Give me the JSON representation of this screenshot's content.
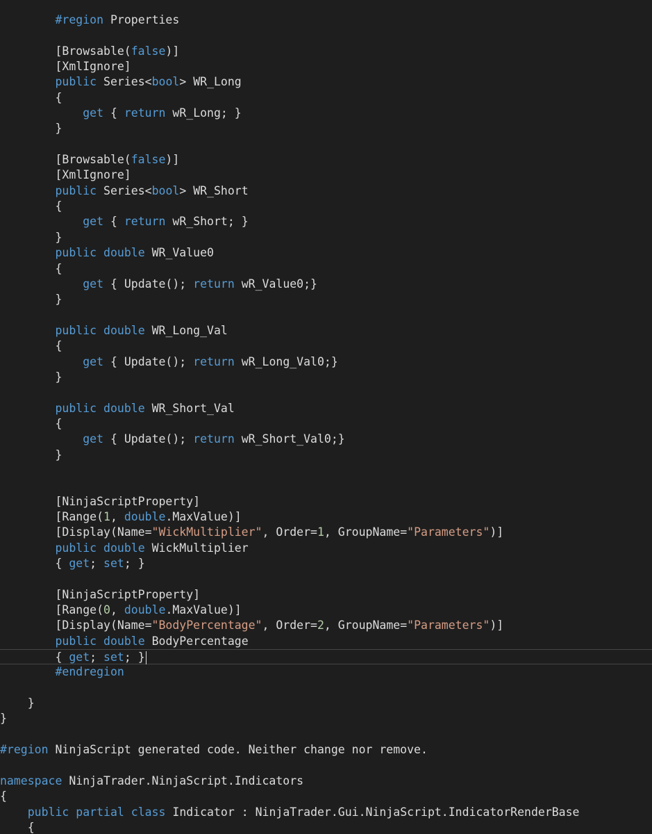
{
  "editor": {
    "theme": {
      "background": "#1e1e1e",
      "text": "#dcdcdc",
      "keyword": "#569cd6",
      "string": "#d69d85",
      "number": "#b5cea8"
    },
    "current_line_index": 41,
    "lines": [
      [
        {
          "t": "        "
        },
        {
          "t": "#region",
          "k": "kw"
        },
        {
          "t": " Properties"
        }
      ],
      [],
      [
        {
          "t": "        [Browsable("
        },
        {
          "t": "false",
          "k": "kw"
        },
        {
          "t": ")]"
        }
      ],
      [
        {
          "t": "        [XmlIgnore]"
        }
      ],
      [
        {
          "t": "        "
        },
        {
          "t": "public",
          "k": "kw"
        },
        {
          "t": " Series<"
        },
        {
          "t": "bool",
          "k": "kw"
        },
        {
          "t": "> WR_Long"
        }
      ],
      [
        {
          "t": "        {"
        }
      ],
      [
        {
          "t": "            "
        },
        {
          "t": "get",
          "k": "kw"
        },
        {
          "t": " { "
        },
        {
          "t": "return",
          "k": "kw"
        },
        {
          "t": " wR_Long; }"
        }
      ],
      [
        {
          "t": "        }"
        }
      ],
      [],
      [
        {
          "t": "        [Browsable("
        },
        {
          "t": "false",
          "k": "kw"
        },
        {
          "t": ")]"
        }
      ],
      [
        {
          "t": "        [XmlIgnore]"
        }
      ],
      [
        {
          "t": "        "
        },
        {
          "t": "public",
          "k": "kw"
        },
        {
          "t": " Series<"
        },
        {
          "t": "bool",
          "k": "kw"
        },
        {
          "t": "> WR_Short"
        }
      ],
      [
        {
          "t": "        {"
        }
      ],
      [
        {
          "t": "            "
        },
        {
          "t": "get",
          "k": "kw"
        },
        {
          "t": " { "
        },
        {
          "t": "return",
          "k": "kw"
        },
        {
          "t": " wR_Short; }"
        }
      ],
      [
        {
          "t": "        }"
        }
      ],
      [
        {
          "t": "        "
        },
        {
          "t": "public",
          "k": "kw"
        },
        {
          "t": " "
        },
        {
          "t": "double",
          "k": "kw"
        },
        {
          "t": " WR_Value0"
        }
      ],
      [
        {
          "t": "        {"
        }
      ],
      [
        {
          "t": "            "
        },
        {
          "t": "get",
          "k": "kw"
        },
        {
          "t": " { Update(); "
        },
        {
          "t": "return",
          "k": "kw"
        },
        {
          "t": " wR_Value0;}"
        }
      ],
      [
        {
          "t": "        }"
        }
      ],
      [],
      [
        {
          "t": "        "
        },
        {
          "t": "public",
          "k": "kw"
        },
        {
          "t": " "
        },
        {
          "t": "double",
          "k": "kw"
        },
        {
          "t": " WR_Long_Val"
        }
      ],
      [
        {
          "t": "        {"
        }
      ],
      [
        {
          "t": "            "
        },
        {
          "t": "get",
          "k": "kw"
        },
        {
          "t": " { Update(); "
        },
        {
          "t": "return",
          "k": "kw"
        },
        {
          "t": " wR_Long_Val0;}"
        }
      ],
      [
        {
          "t": "        }"
        }
      ],
      [],
      [
        {
          "t": "        "
        },
        {
          "t": "public",
          "k": "kw"
        },
        {
          "t": " "
        },
        {
          "t": "double",
          "k": "kw"
        },
        {
          "t": " WR_Short_Val"
        }
      ],
      [
        {
          "t": "        {"
        }
      ],
      [
        {
          "t": "            "
        },
        {
          "t": "get",
          "k": "kw"
        },
        {
          "t": " { Update(); "
        },
        {
          "t": "return",
          "k": "kw"
        },
        {
          "t": " wR_Short_Val0;}"
        }
      ],
      [
        {
          "t": "        }"
        }
      ],
      [],
      [],
      [
        {
          "t": "        [NinjaScriptProperty]"
        }
      ],
      [
        {
          "t": "        [Range("
        },
        {
          "t": "1",
          "k": "num"
        },
        {
          "t": ", "
        },
        {
          "t": "double",
          "k": "kw"
        },
        {
          "t": ".MaxValue)]"
        }
      ],
      [
        {
          "t": "        [Display(Name="
        },
        {
          "t": "\"WickMultiplier\"",
          "k": "str"
        },
        {
          "t": ", Order="
        },
        {
          "t": "1",
          "k": "num"
        },
        {
          "t": ", GroupName="
        },
        {
          "t": "\"Parameters\"",
          "k": "str"
        },
        {
          "t": ")]"
        }
      ],
      [
        {
          "t": "        "
        },
        {
          "t": "public",
          "k": "kw"
        },
        {
          "t": " "
        },
        {
          "t": "double",
          "k": "kw"
        },
        {
          "t": " WickMultiplier"
        }
      ],
      [
        {
          "t": "        { "
        },
        {
          "t": "get",
          "k": "kw"
        },
        {
          "t": "; "
        },
        {
          "t": "set",
          "k": "kw"
        },
        {
          "t": "; }"
        }
      ],
      [],
      [
        {
          "t": "        [NinjaScriptProperty]"
        }
      ],
      [
        {
          "t": "        [Range("
        },
        {
          "t": "0",
          "k": "num"
        },
        {
          "t": ", "
        },
        {
          "t": "double",
          "k": "kw"
        },
        {
          "t": ".MaxValue)]"
        }
      ],
      [
        {
          "t": "        [Display(Name="
        },
        {
          "t": "\"BodyPercentage\"",
          "k": "str"
        },
        {
          "t": ", Order="
        },
        {
          "t": "2",
          "k": "num"
        },
        {
          "t": ", GroupName="
        },
        {
          "t": "\"Parameters\"",
          "k": "str"
        },
        {
          "t": ")]"
        }
      ],
      [
        {
          "t": "        "
        },
        {
          "t": "public",
          "k": "kw"
        },
        {
          "t": " "
        },
        {
          "t": "double",
          "k": "kw"
        },
        {
          "t": " BodyPercentage"
        }
      ],
      [
        {
          "t": "        { "
        },
        {
          "t": "get",
          "k": "kw"
        },
        {
          "t": "; "
        },
        {
          "t": "set",
          "k": "kw"
        },
        {
          "t": "; }"
        }
      ],
      [
        {
          "t": "        "
        },
        {
          "t": "#endregion",
          "k": "kw"
        }
      ],
      [],
      [
        {
          "t": "    }"
        }
      ],
      [
        {
          "t": "}"
        }
      ],
      [],
      [
        {
          "t": "#region",
          "k": "kw"
        },
        {
          "t": " NinjaScript generated code. Neither change nor remove."
        }
      ],
      [],
      [
        {
          "t": "namespace",
          "k": "kw"
        },
        {
          "t": " NinjaTrader.NinjaScript.Indicators"
        }
      ],
      [
        {
          "t": "{"
        }
      ],
      [
        {
          "t": "    "
        },
        {
          "t": "public",
          "k": "kw"
        },
        {
          "t": " "
        },
        {
          "t": "partial",
          "k": "kw"
        },
        {
          "t": " "
        },
        {
          "t": "class",
          "k": "kw"
        },
        {
          "t": " Indicator : NinjaTrader.Gui.NinjaScript.IndicatorRenderBase"
        }
      ],
      [
        {
          "t": "    {"
        }
      ]
    ]
  }
}
